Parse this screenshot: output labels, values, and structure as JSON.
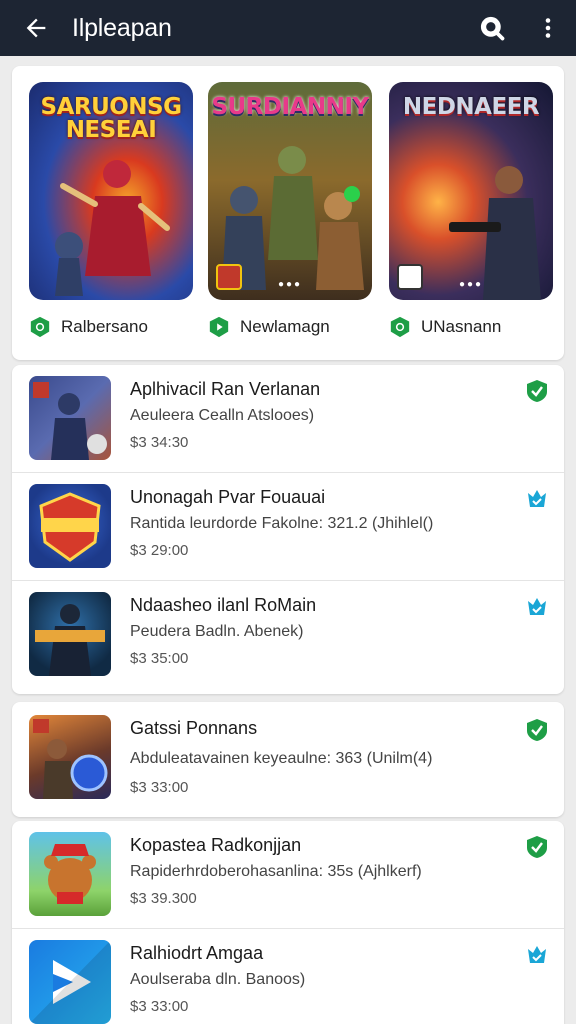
{
  "appbar": {
    "title": "Ilpleapan",
    "back_icon": "arrow-left-icon",
    "search_icon": "search-icon",
    "menu_icon": "more-vertical-icon",
    "background": "#1d2533"
  },
  "featured": [
    {
      "logo": "SARUONSG NESEAI",
      "name": "Ralbersano",
      "status": "verified-shield"
    },
    {
      "logo": "SURDIANNIY",
      "name": "Newlamagn",
      "status": "play-shield"
    },
    {
      "logo": "NEDNAEER",
      "name": "UNasnann",
      "status": "verified-shield"
    }
  ],
  "list": [
    {
      "name": "Aplhivacil Ran Verlanan",
      "desc": "Aeuleera Cealln Atslooes)",
      "price": "$3 34:30",
      "status": "verified"
    },
    {
      "name": "Unonagah Pvar Fouauai",
      "desc": "Rantida leurdorde Fakolne: 321.2 (Jhihlel()",
      "price": "$3 29:00",
      "status": "award"
    },
    {
      "name": "Ndaasheo ilanl RoMain",
      "desc": "Peudera Badln. Abenek)",
      "price": "$3 35:00",
      "status": "award"
    },
    {
      "name": "Gatssi Ponnans",
      "desc": "Abduleatavainen keyeaulne: 363 (Unilm(4)",
      "price": "$3 33:00",
      "status": "verified"
    },
    {
      "name": "Kopastea Radkonjjan",
      "desc": "Rapiderhrdoberohasanlina: 35s (Ajhlkerf)",
      "price": "$3 39.300",
      "status": "verified"
    },
    {
      "name": "Ralhiodrt Amgaa",
      "desc": "Aoulseraba dln. Banoos)",
      "price": "$3 33:00",
      "status": "award"
    }
  ],
  "colors": {
    "verified": "#1e9e46",
    "award": "#1aa6d6"
  }
}
